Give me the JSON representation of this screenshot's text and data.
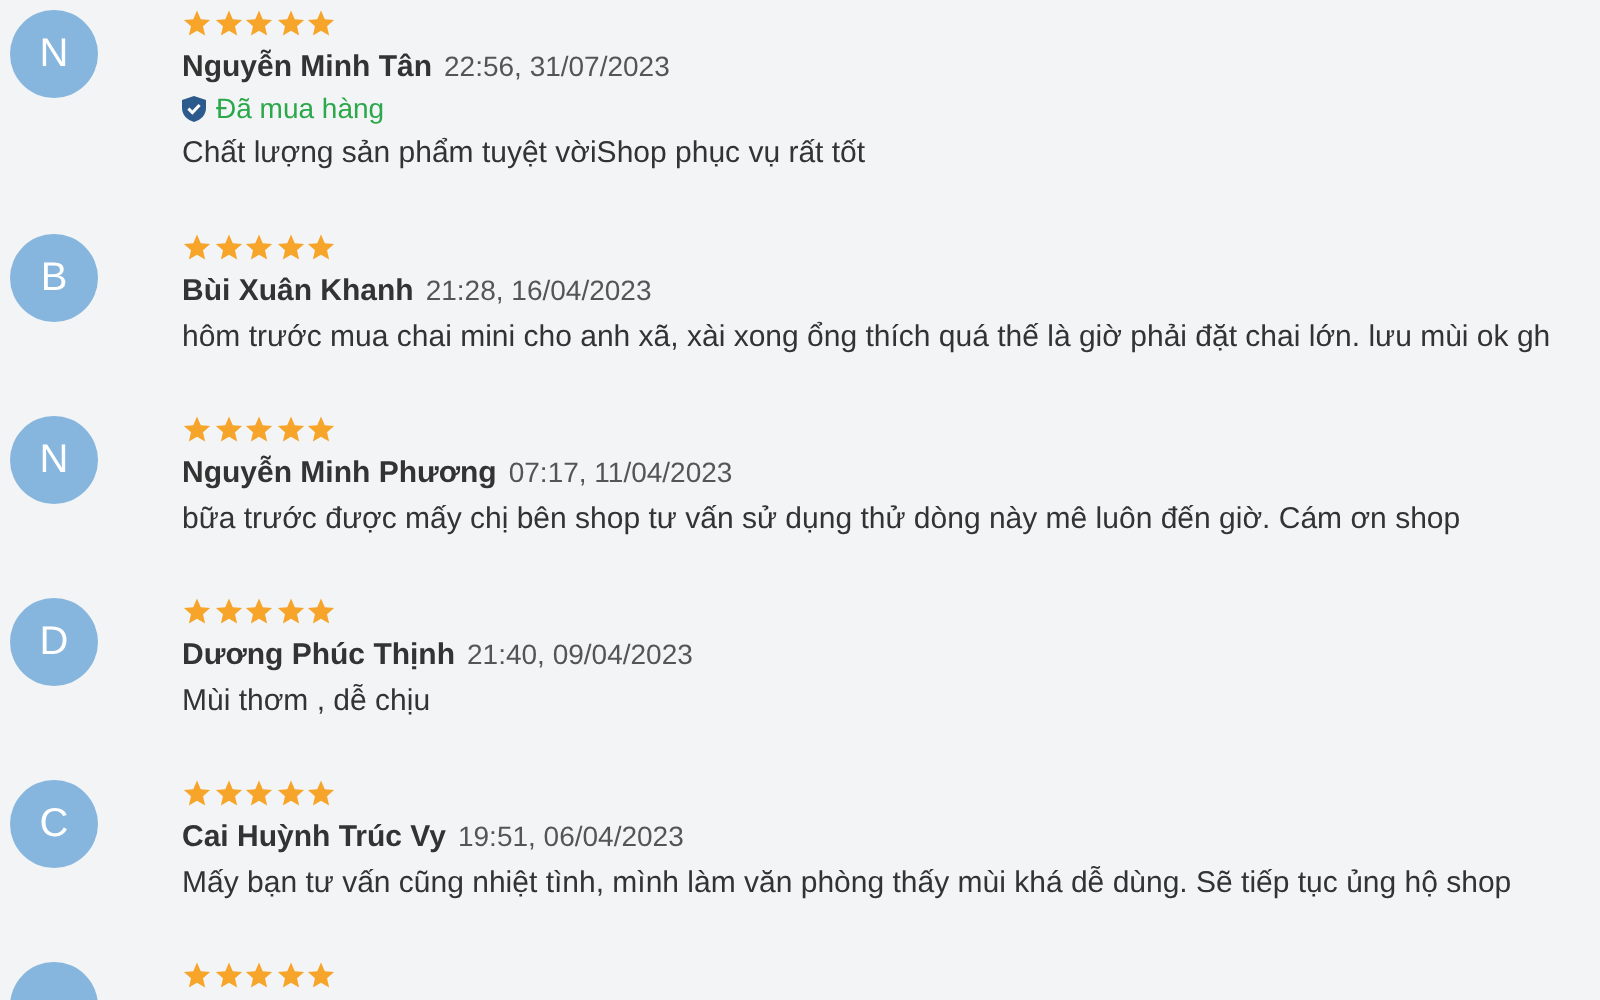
{
  "reviews": [
    {
      "initial": "N",
      "stars": 5,
      "name": "Nguyễn Minh Tân",
      "time": "22:56, 31/07/2023",
      "verified": true,
      "verified_label": "Đã mua hàng",
      "text": "Chất lượng sản phẩm tuyệt vờiShop phục vụ rất tốt"
    },
    {
      "initial": "B",
      "stars": 5,
      "name": "Bùi Xuân Khanh",
      "time": "21:28, 16/04/2023",
      "verified": false,
      "text": "hôm trước mua chai mini cho anh xã, xài xong ổng thích quá thế là giờ phải đặt chai lớn. lưu mùi ok gh"
    },
    {
      "initial": "N",
      "stars": 5,
      "name": "Nguyễn Minh Phương",
      "time": "07:17, 11/04/2023",
      "verified": false,
      "text": "bữa trước được mấy chị bên shop tư vấn sử dụng thử dòng này mê luôn đến giờ. Cám ơn shop"
    },
    {
      "initial": "D",
      "stars": 5,
      "name": "Dương Phúc Thịnh",
      "time": "21:40, 09/04/2023",
      "verified": false,
      "text": "Mùi thơm , dễ chịu"
    },
    {
      "initial": "C",
      "stars": 5,
      "name": "Cai Huỳnh Trúc Vy",
      "time": "19:51, 06/04/2023",
      "verified": false,
      "text": "Mấy bạn tư vấn cũng nhiệt tình, mình làm văn phòng thấy mùi khá dễ dùng. Sẽ tiếp tục ủng hộ shop"
    },
    {
      "stars": 5
    }
  ]
}
